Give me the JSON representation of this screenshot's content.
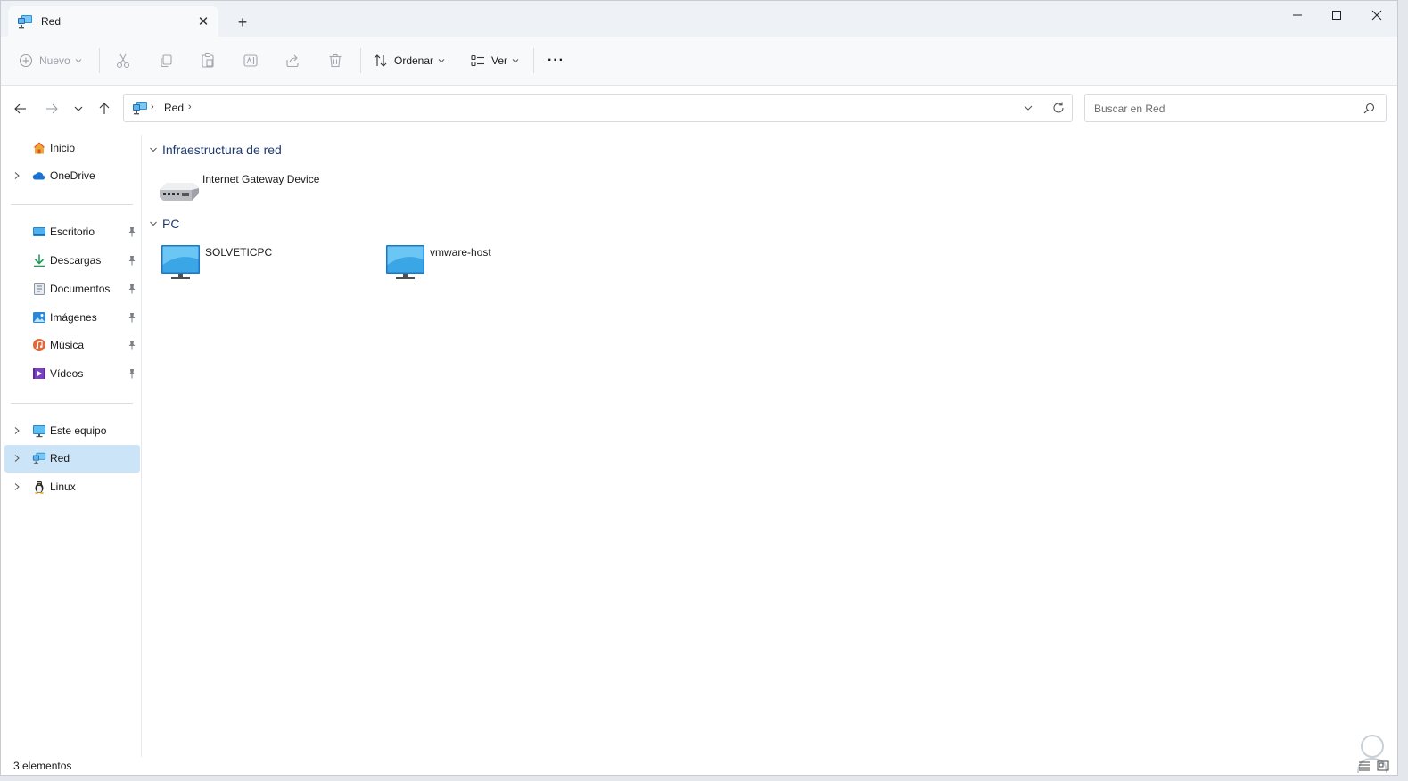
{
  "window": {
    "tab_title": "Red",
    "new_tab_symbol": "+",
    "close_tab_symbol": "✕"
  },
  "toolbar": {
    "new_label": "Nuevo",
    "sort_label": "Ordenar",
    "view_label": "Ver",
    "more_symbol": "···"
  },
  "address": {
    "crumbs": [
      "Red"
    ],
    "separator": "›"
  },
  "search": {
    "placeholder": "Buscar en Red"
  },
  "sidebar": {
    "items": [
      {
        "label": "Inicio",
        "icon": "home-icon",
        "expandable": false,
        "pinned": false
      },
      {
        "label": "OneDrive",
        "icon": "onedrive-icon",
        "expandable": true,
        "pinned": false
      },
      {
        "label": "Escritorio",
        "icon": "desktop-icon",
        "expandable": false,
        "pinned": true
      },
      {
        "label": "Descargas",
        "icon": "downloads-icon",
        "expandable": false,
        "pinned": true
      },
      {
        "label": "Documentos",
        "icon": "documents-icon",
        "expandable": false,
        "pinned": true
      },
      {
        "label": "Imágenes",
        "icon": "pictures-icon",
        "expandable": false,
        "pinned": true
      },
      {
        "label": "Música",
        "icon": "music-icon",
        "expandable": false,
        "pinned": true
      },
      {
        "label": "Vídeos",
        "icon": "videos-icon",
        "expandable": false,
        "pinned": true
      },
      {
        "label": "Este equipo",
        "icon": "this-pc-icon",
        "expandable": true,
        "pinned": false
      },
      {
        "label": "Red",
        "icon": "network-icon",
        "expandable": true,
        "pinned": false,
        "selected": true
      },
      {
        "label": "Linux",
        "icon": "linux-icon",
        "expandable": true,
        "pinned": false
      }
    ]
  },
  "content": {
    "groups": [
      {
        "title": "Infraestructura de red",
        "items": [
          {
            "label": "Internet Gateway Device",
            "icon": "router-icon"
          }
        ]
      },
      {
        "title": "PC",
        "items": [
          {
            "label": "SOLVETICPC",
            "icon": "monitor-icon"
          },
          {
            "label": "vmware-host",
            "icon": "monitor-icon"
          }
        ]
      }
    ]
  },
  "status": {
    "count_text": "3 elementos"
  },
  "colors": {
    "accent": "#0067c0",
    "selection": "#cce4f7",
    "group_title": "#1e3a70",
    "titlebar": "#eef2f6"
  }
}
